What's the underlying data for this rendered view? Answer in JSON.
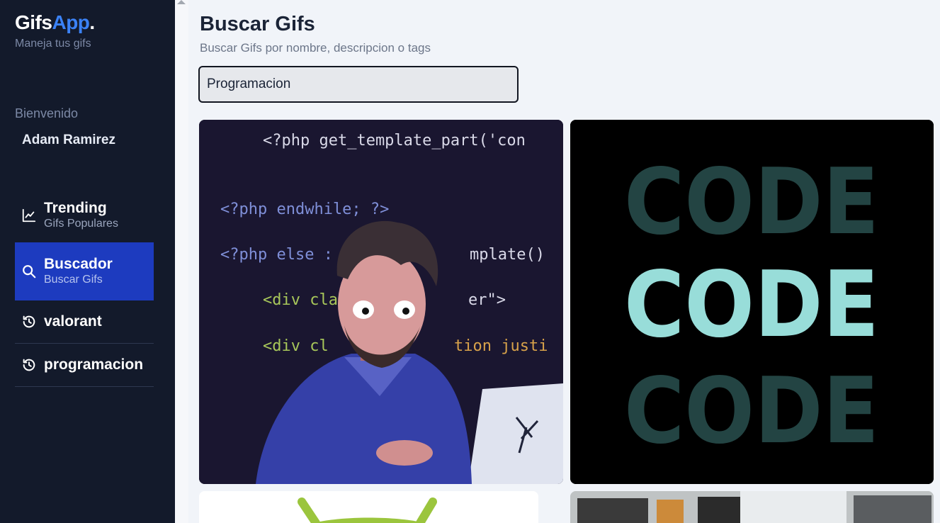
{
  "brand": {
    "name": "Gifs",
    "accent": "App",
    "dot": ".",
    "subtitle": "Maneja tus gifs"
  },
  "sidebar": {
    "welcome": "Bienvenido",
    "user": "Adam Ramirez",
    "items": [
      {
        "title": "Trending",
        "subtitle": "Gifs Populares",
        "icon": "trending-icon"
      },
      {
        "title": "Buscador",
        "subtitle": "Buscar Gifs",
        "icon": "search-icon",
        "active": true
      },
      {
        "title": "valorant",
        "icon": "history-icon"
      },
      {
        "title": "programacion",
        "icon": "history-icon"
      }
    ]
  },
  "main": {
    "title": "Buscar Gifs",
    "subtitle": "Buscar Gifs por nombre, descripcion o tags",
    "search_value": "Programacion"
  },
  "gifs": [
    {
      "name": "programmer-gif",
      "code_lines": [
        "<?php get_template_part('con",
        "<?php endwhile; ?>",
        "<?php else : ",
        "mplate()",
        "<div cla",
        "er\">",
        "<div cl",
        "tion justi"
      ]
    },
    {
      "name": "code-code-code-gif",
      "words": [
        "CODE",
        "CODE",
        "CODE"
      ]
    },
    {
      "name": "android-gif"
    },
    {
      "name": "office-gif"
    }
  ],
  "colors": {
    "sidebar": "#131a2b",
    "active": "#1d3bbf",
    "accent": "#3b82f6",
    "code_dark": "#234443",
    "code_light": "#98ddd9"
  }
}
